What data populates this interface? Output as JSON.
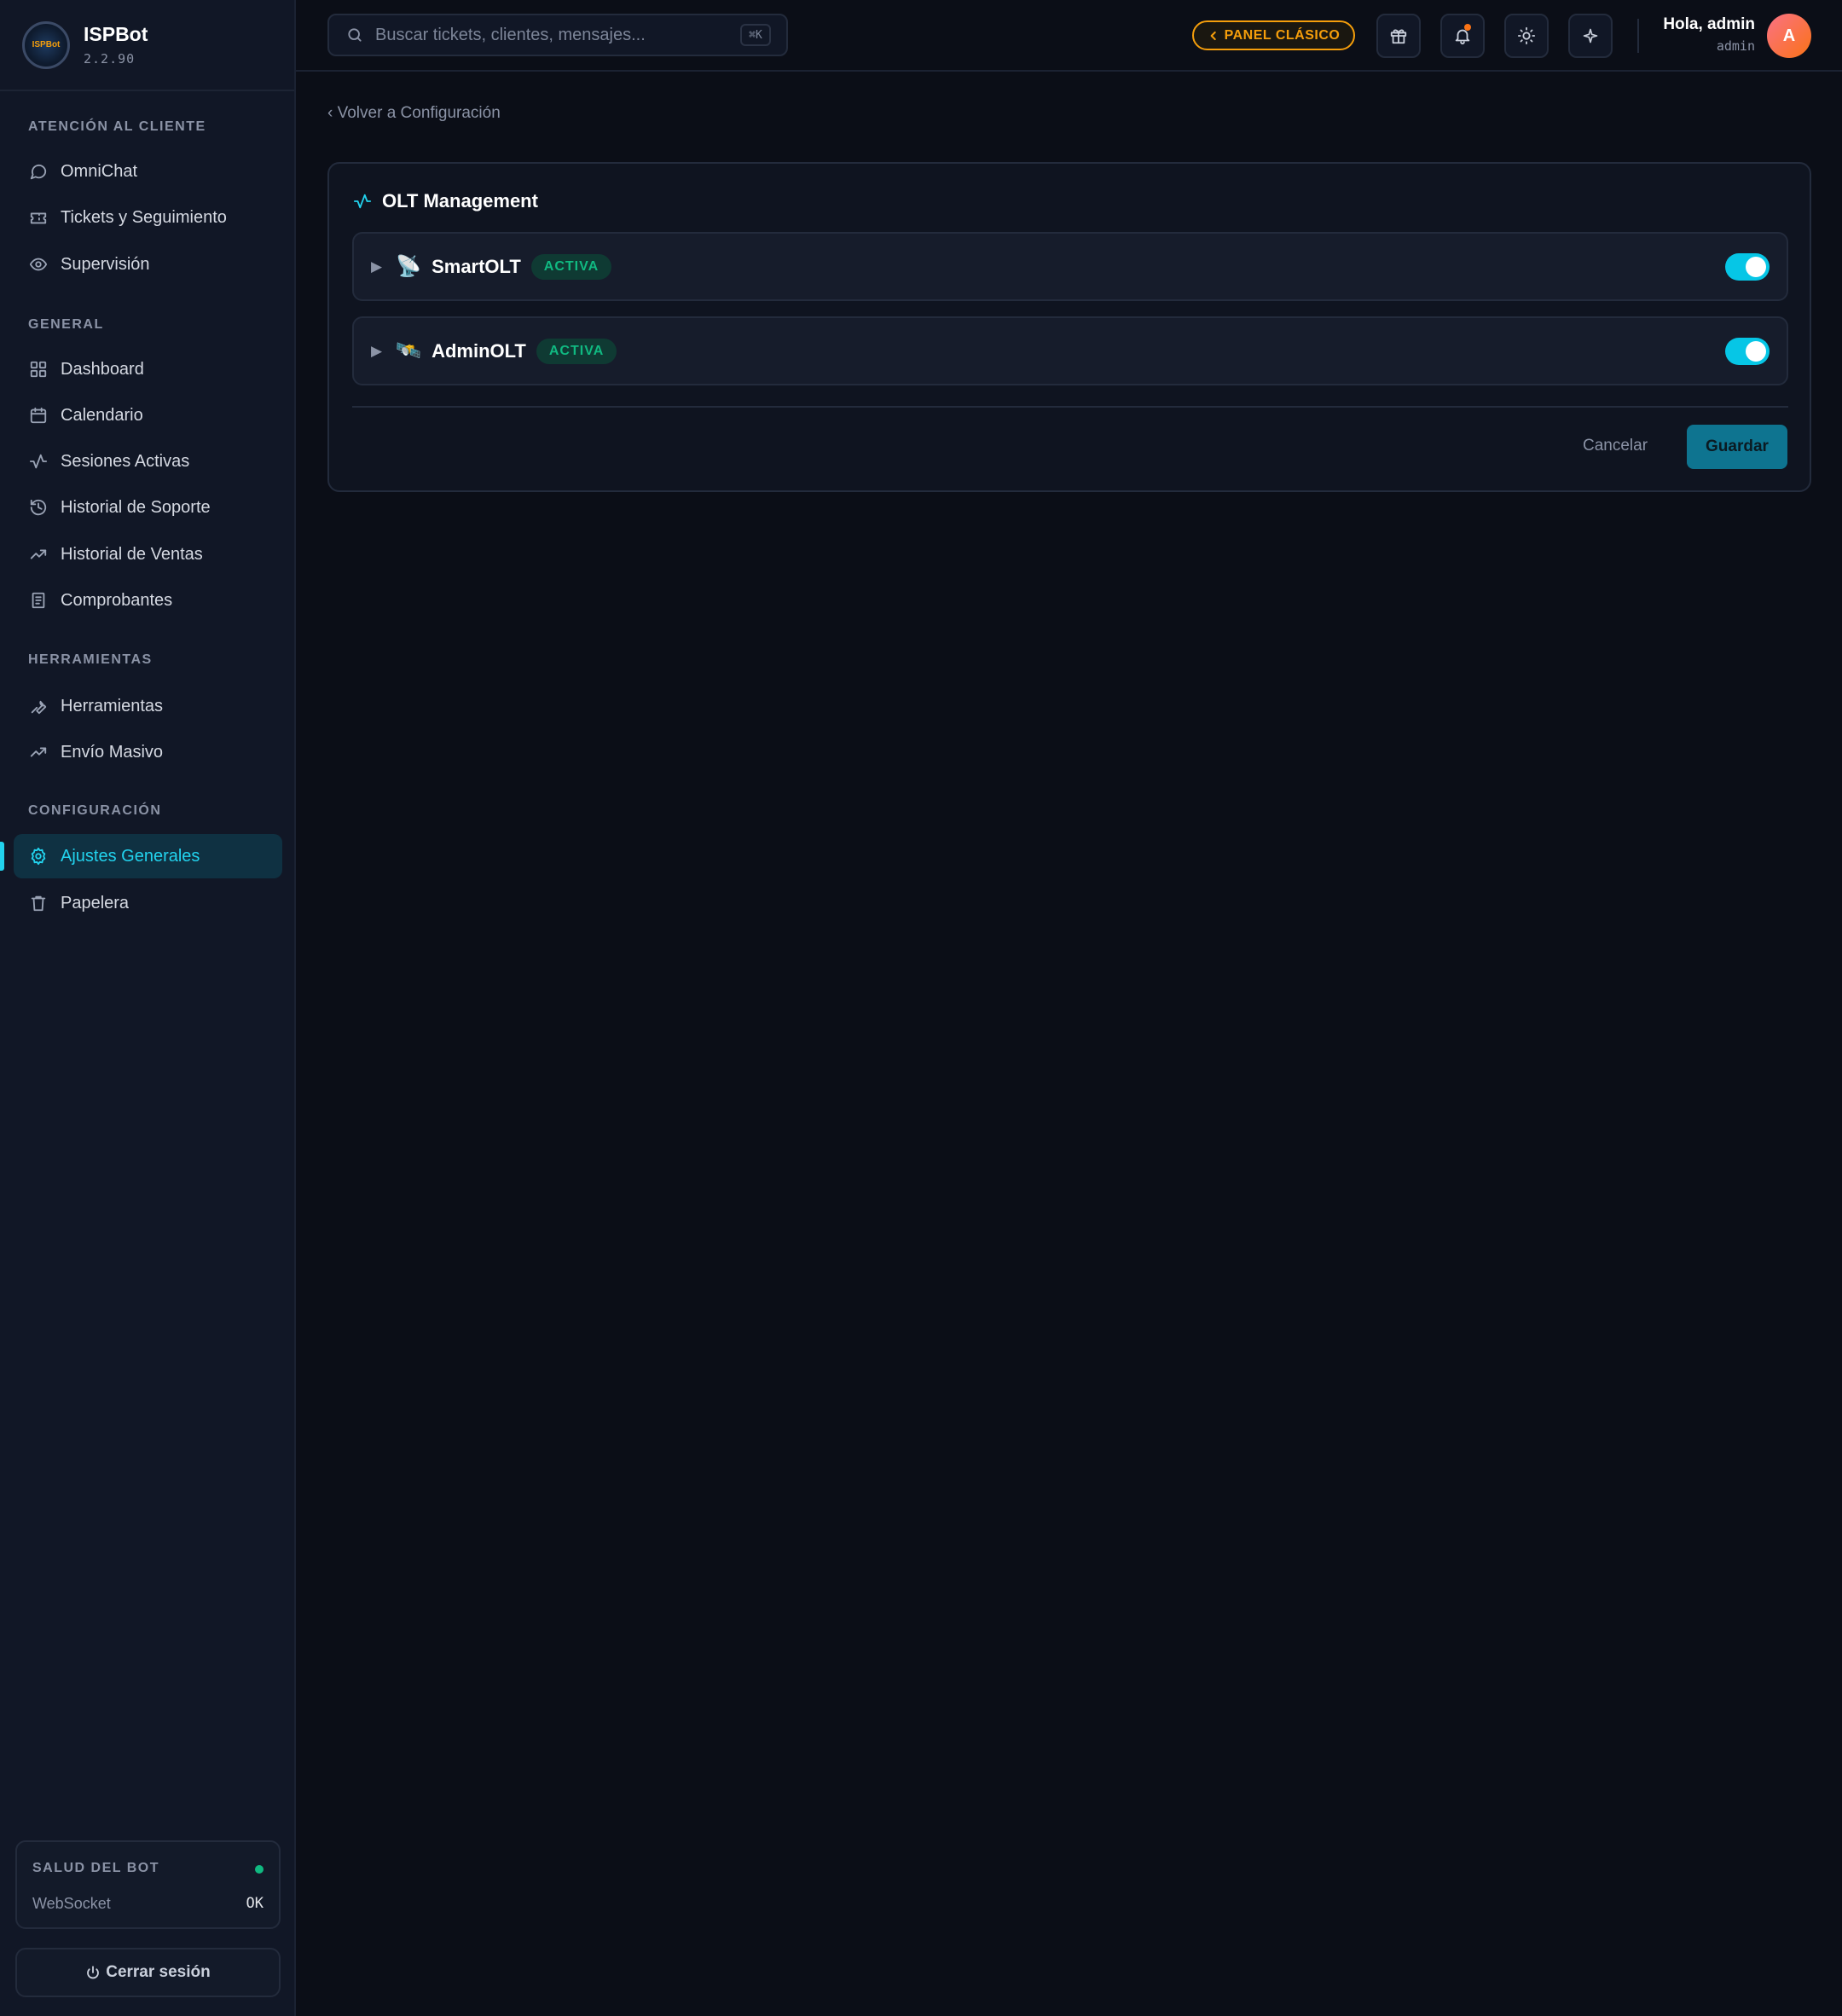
{
  "brand": {
    "name": "ISPBot",
    "version": "2.2.90",
    "logo_text": "ISPBot"
  },
  "sidebar": {
    "sections": [
      {
        "title": "ATENCIÓN AL CLIENTE"
      },
      {
        "title": "GENERAL"
      },
      {
        "title": "HERRAMIENTAS"
      },
      {
        "title": "CONFIGURACIÓN"
      }
    ],
    "items": [
      {
        "label": "OmniChat",
        "icon": "chat-bubble-icon"
      },
      {
        "label": "Tickets y Seguimiento",
        "icon": "ticket-icon"
      },
      {
        "label": "Supervisión",
        "icon": "eye-icon"
      },
      {
        "label": "Dashboard",
        "icon": "grid-icon"
      },
      {
        "label": "Calendario",
        "icon": "calendar-icon"
      },
      {
        "label": "Sesiones Activas",
        "icon": "activity-icon"
      },
      {
        "label": "Historial de Soporte",
        "icon": "history-icon"
      },
      {
        "label": "Historial de Ventas",
        "icon": "trending-up-icon"
      },
      {
        "label": "Comprobantes",
        "icon": "receipt-icon"
      },
      {
        "label": "Herramientas",
        "icon": "wrench-icon"
      },
      {
        "label": "Envío Masivo",
        "icon": "trending-up-icon"
      },
      {
        "label": "Ajustes Generales",
        "icon": "gear-icon",
        "active": true
      },
      {
        "label": "Papelera",
        "icon": "trash-icon"
      }
    ],
    "health": {
      "title": "SALUD DEL BOT",
      "label": "WebSocket",
      "value": "OK",
      "status_color": "#10b981"
    },
    "logout_label": "Cerrar sesión"
  },
  "header": {
    "search_placeholder": "Buscar tickets, clientes, mensajes...",
    "search_shortcut": "⌘K",
    "panel_button": "PANEL CLÁSICO",
    "icons": [
      "gift-icon",
      "bell-icon",
      "sun-icon",
      "sparkle-icon"
    ],
    "greeting": "Hola, admin",
    "role": "admin",
    "avatar_initial": "A"
  },
  "main": {
    "back_link": "‹ Volver a Configuración",
    "card": {
      "title": "OLT Management",
      "rows": [
        {
          "emoji": "📡",
          "name": "SmartOLT",
          "badge": "ACTIVA",
          "enabled": true
        },
        {
          "emoji": "🛰️",
          "name": "AdminOLT",
          "badge": "ACTIVA",
          "enabled": true
        }
      ],
      "cancel_label": "Cancelar",
      "save_label": "Guardar"
    }
  },
  "colors": {
    "accent": "#22d3ee",
    "warning": "#f59e0b",
    "success": "#10b981",
    "background": "#0b0e17"
  }
}
